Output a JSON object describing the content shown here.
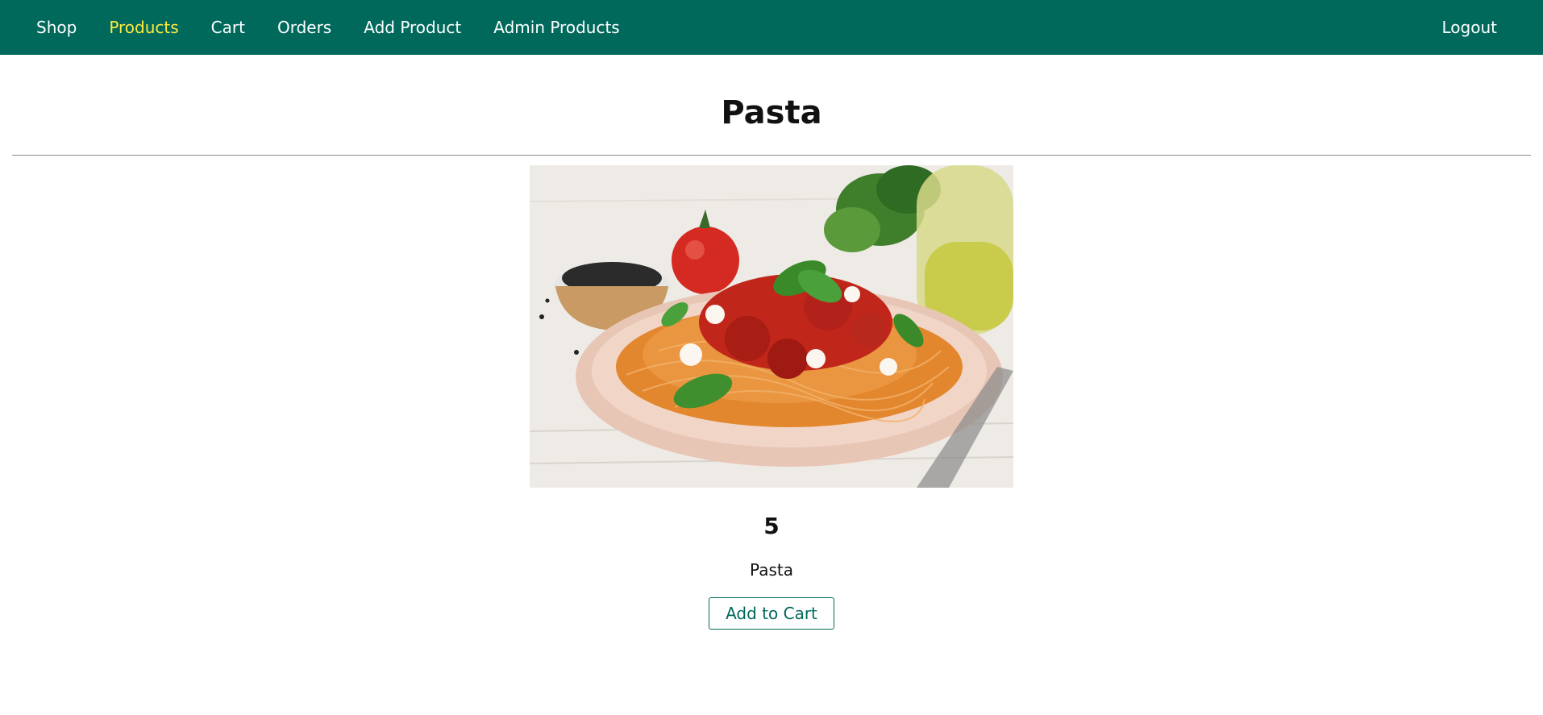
{
  "nav": {
    "items": [
      {
        "label": "Shop",
        "active": false
      },
      {
        "label": "Products",
        "active": true
      },
      {
        "label": "Cart",
        "active": false
      },
      {
        "label": "Orders",
        "active": false
      },
      {
        "label": "Add Product",
        "active": false
      },
      {
        "label": "Admin Products",
        "active": false
      }
    ],
    "logout_label": "Logout"
  },
  "product": {
    "title": "Pasta",
    "price": "5",
    "description": "Pasta",
    "image_icon": "pasta-dish-image"
  },
  "actions": {
    "add_to_cart_label": "Add to Cart"
  },
  "colors": {
    "header_bg": "#00695c",
    "active_nav": "#ffeb3b",
    "accent": "#00695c"
  }
}
